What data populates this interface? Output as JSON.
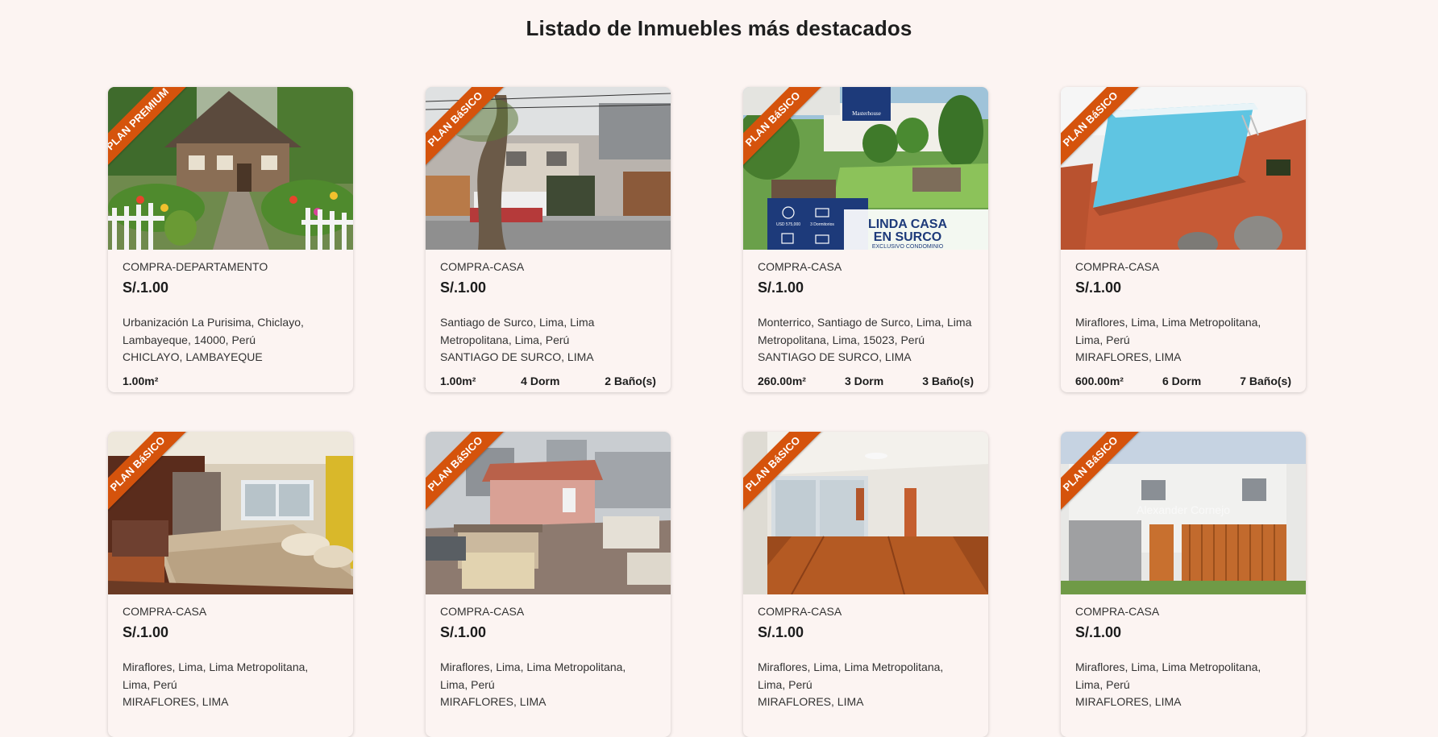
{
  "page_title": "Listado de Inmuebles más destacados",
  "colors": {
    "background": "#fcf4f2",
    "ribbon": "#d5530c",
    "text": "#222222"
  },
  "listings": [
    {
      "plan": "PLAN PREMIUM",
      "operation": "COMPRA-DEPARTAMENTO",
      "price": "S/.1.00",
      "address": "Urbanización La Purisima, Chiclayo, Lambayeque, 14000, Perú",
      "location": "CHICLAYO, LAMBAYEQUE",
      "area": "1.00m²",
      "bedrooms": "",
      "bathrooms": "",
      "image": "cottage-garden-photo"
    },
    {
      "plan": "PLAN BáSICO",
      "operation": "COMPRA-CASA",
      "price": "S/.1.00",
      "address": "Santiago de Surco, Lima, Lima Metropolitana, Lima, Perú",
      "location": "SANTIAGO DE SURCO, LIMA",
      "area": "1.00m²",
      "bedrooms": "4 Dorm",
      "bathrooms": "2 Baño(s)",
      "image": "street-facade-photo"
    },
    {
      "plan": "PLAN BáSICO",
      "operation": "COMPRA-CASA",
      "price": "S/.1.00",
      "address": "Monterrico, Santiago de Surco, Lima, Lima Metropolitana, Lima, 15023, Perú",
      "location": "SANTIAGO DE SURCO, LIMA",
      "area": "260.00m²",
      "bedrooms": "3 Dorm",
      "bathrooms": "3 Baño(s)",
      "image": "garden-flyer-photo",
      "flyer": {
        "brand": "Masterhouse",
        "headline_1": "LINDA CASA",
        "headline_2": "EN SURCO",
        "subline": "EXCLUSIVO CONDOMINIO",
        "price_tag": "USD 575,000",
        "rooms_tag": "3 Dormitorios"
      }
    },
    {
      "plan": "PLAN BáSICO",
      "operation": "COMPRA-CASA",
      "price": "S/.1.00",
      "address": "Miraflores, Lima, Lima Metropolitana, Lima, Perú",
      "location": "MIRAFLORES, LIMA",
      "area": "600.00m²",
      "bedrooms": "6 Dorm",
      "bathrooms": "7 Baño(s)",
      "image": "pool-terrace-photo"
    },
    {
      "plan": "PLAN BáSICO",
      "operation": "COMPRA-CASA",
      "price": "S/.1.00",
      "address": "Miraflores, Lima, Lima Metropolitana, Lima, Perú",
      "location": "MIRAFLORES, LIMA",
      "image": "bedroom-photo"
    },
    {
      "plan": "PLAN BáSICO",
      "operation": "COMPRA-CASA",
      "price": "S/.1.00",
      "address": "Miraflores, Lima, Lima Metropolitana, Lima, Perú",
      "location": "MIRAFLORES, LIMA",
      "image": "rooftop-photo"
    },
    {
      "plan": "PLAN BáSICO",
      "operation": "COMPRA-CASA",
      "price": "S/.1.00",
      "address": "Miraflores, Lima, Lima Metropolitana, Lima, Perú",
      "location": "MIRAFLORES, LIMA",
      "image": "living-room-photo"
    },
    {
      "plan": "PLAN BáSICO",
      "operation": "COMPRA-CASA",
      "price": "S/.1.00",
      "address": "Miraflores, Lima, Lima Metropolitana, Lima, Perú",
      "location": "MIRAFLORES, LIMA",
      "image": "white-house-photo",
      "watermark": "Alexander Cornejo"
    }
  ]
}
